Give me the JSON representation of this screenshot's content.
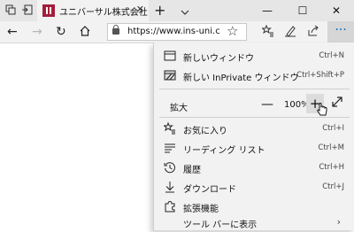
{
  "tab": {
    "title": "ユニバーサル株式会社",
    "close": "✕"
  },
  "window": {
    "minimize": "—",
    "maximize": "☐",
    "close": "✕",
    "new_tab": "+"
  },
  "address": {
    "url": "https://www.ins-uni.c"
  },
  "menu": {
    "new_window": {
      "label": "新しいウィンドウ",
      "shortcut": "Ctrl+N"
    },
    "new_inprivate": {
      "label": "新しい InPrivate ウィンドウ",
      "shortcut": "Ctrl+Shift+P"
    },
    "zoom": {
      "label": "拡大",
      "minus": "—",
      "value": "100%",
      "plus": "+"
    },
    "favorites": {
      "label": "お気に入り",
      "shortcut": "Ctrl+I"
    },
    "reading_list": {
      "label": "リーディング リスト",
      "shortcut": "Ctrl+M"
    },
    "history": {
      "label": "履歴",
      "shortcut": "Ctrl+H"
    },
    "downloads": {
      "label": "ダウンロード",
      "shortcut": "Ctrl+J"
    },
    "extensions": {
      "label": "拡張機能"
    },
    "show_toolbar": {
      "label": "ツール バーに表示"
    }
  }
}
